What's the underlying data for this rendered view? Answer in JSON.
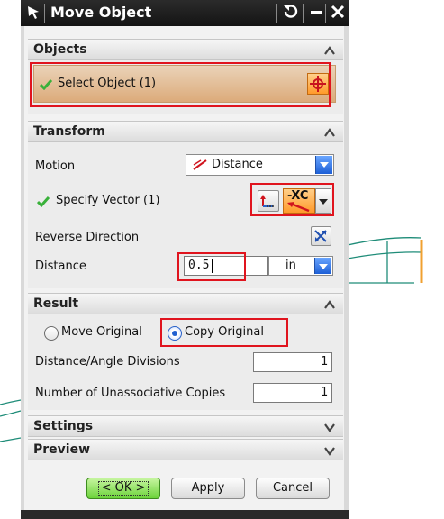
{
  "dialog": {
    "title": "Move Object",
    "title_buttons": [
      "↺",
      "−",
      "✕"
    ]
  },
  "objects": {
    "header": "Objects",
    "select_label": "Select Object (1)"
  },
  "transform": {
    "header": "Transform",
    "motion_label": "Motion",
    "motion_value": "Distance",
    "vector_label": "Specify Vector (1)",
    "vector_axis": "-XC",
    "reverse_label": "Reverse Direction",
    "distance_label": "Distance",
    "distance_value": "0.5",
    "distance_unit": "in"
  },
  "result": {
    "header": "Result",
    "options": [
      "Move Original",
      "Copy Original"
    ],
    "selected": "Copy Original",
    "divisions_label": "Distance/Angle Divisions",
    "divisions_value": "1",
    "copies_label": "Number of Unassociative Copies",
    "copies_value": "1"
  },
  "settings": {
    "header": "Settings"
  },
  "preview": {
    "header": "Preview"
  },
  "buttons": {
    "ok": "< OK >",
    "apply": "Apply",
    "cancel": "Cancel"
  },
  "colors": {
    "highlight": "#e0141e",
    "cad_geometry": "#1e8c78",
    "cad_edge": "#f0a030",
    "check": "#39b13a"
  }
}
